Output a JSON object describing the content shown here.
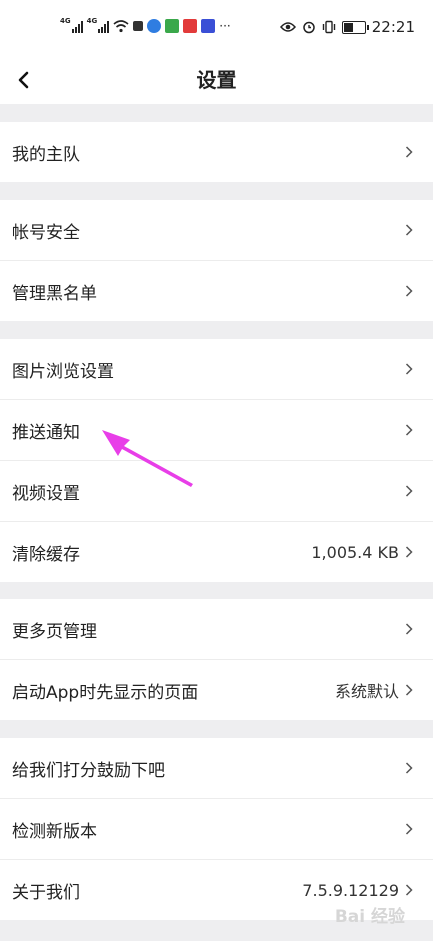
{
  "status_bar": {
    "network_1": "4G",
    "network_2": "4G",
    "time": "22:21"
  },
  "header": {
    "title": "设置"
  },
  "groups": [
    {
      "items": [
        {
          "label": "我的主队",
          "value": ""
        }
      ]
    },
    {
      "items": [
        {
          "label": "帐号安全",
          "value": ""
        },
        {
          "label": "管理黑名单",
          "value": ""
        }
      ]
    },
    {
      "items": [
        {
          "label": "图片浏览设置",
          "value": ""
        },
        {
          "label": "推送通知",
          "value": ""
        },
        {
          "label": "视频设置",
          "value": ""
        },
        {
          "label": "清除缓存",
          "value": "1,005.4 KB"
        }
      ]
    },
    {
      "items": [
        {
          "label": "更多页管理",
          "value": ""
        },
        {
          "label": "启动App时先显示的页面",
          "value": "系统默认"
        }
      ]
    },
    {
      "items": [
        {
          "label": "给我们打分鼓励下吧",
          "value": ""
        },
        {
          "label": "检测新版本",
          "value": ""
        },
        {
          "label": "关于我们",
          "value": "7.5.9.12129"
        }
      ]
    }
  ],
  "annotation": {
    "color": "#e83ee8"
  },
  "watermark": "Bai 经验"
}
